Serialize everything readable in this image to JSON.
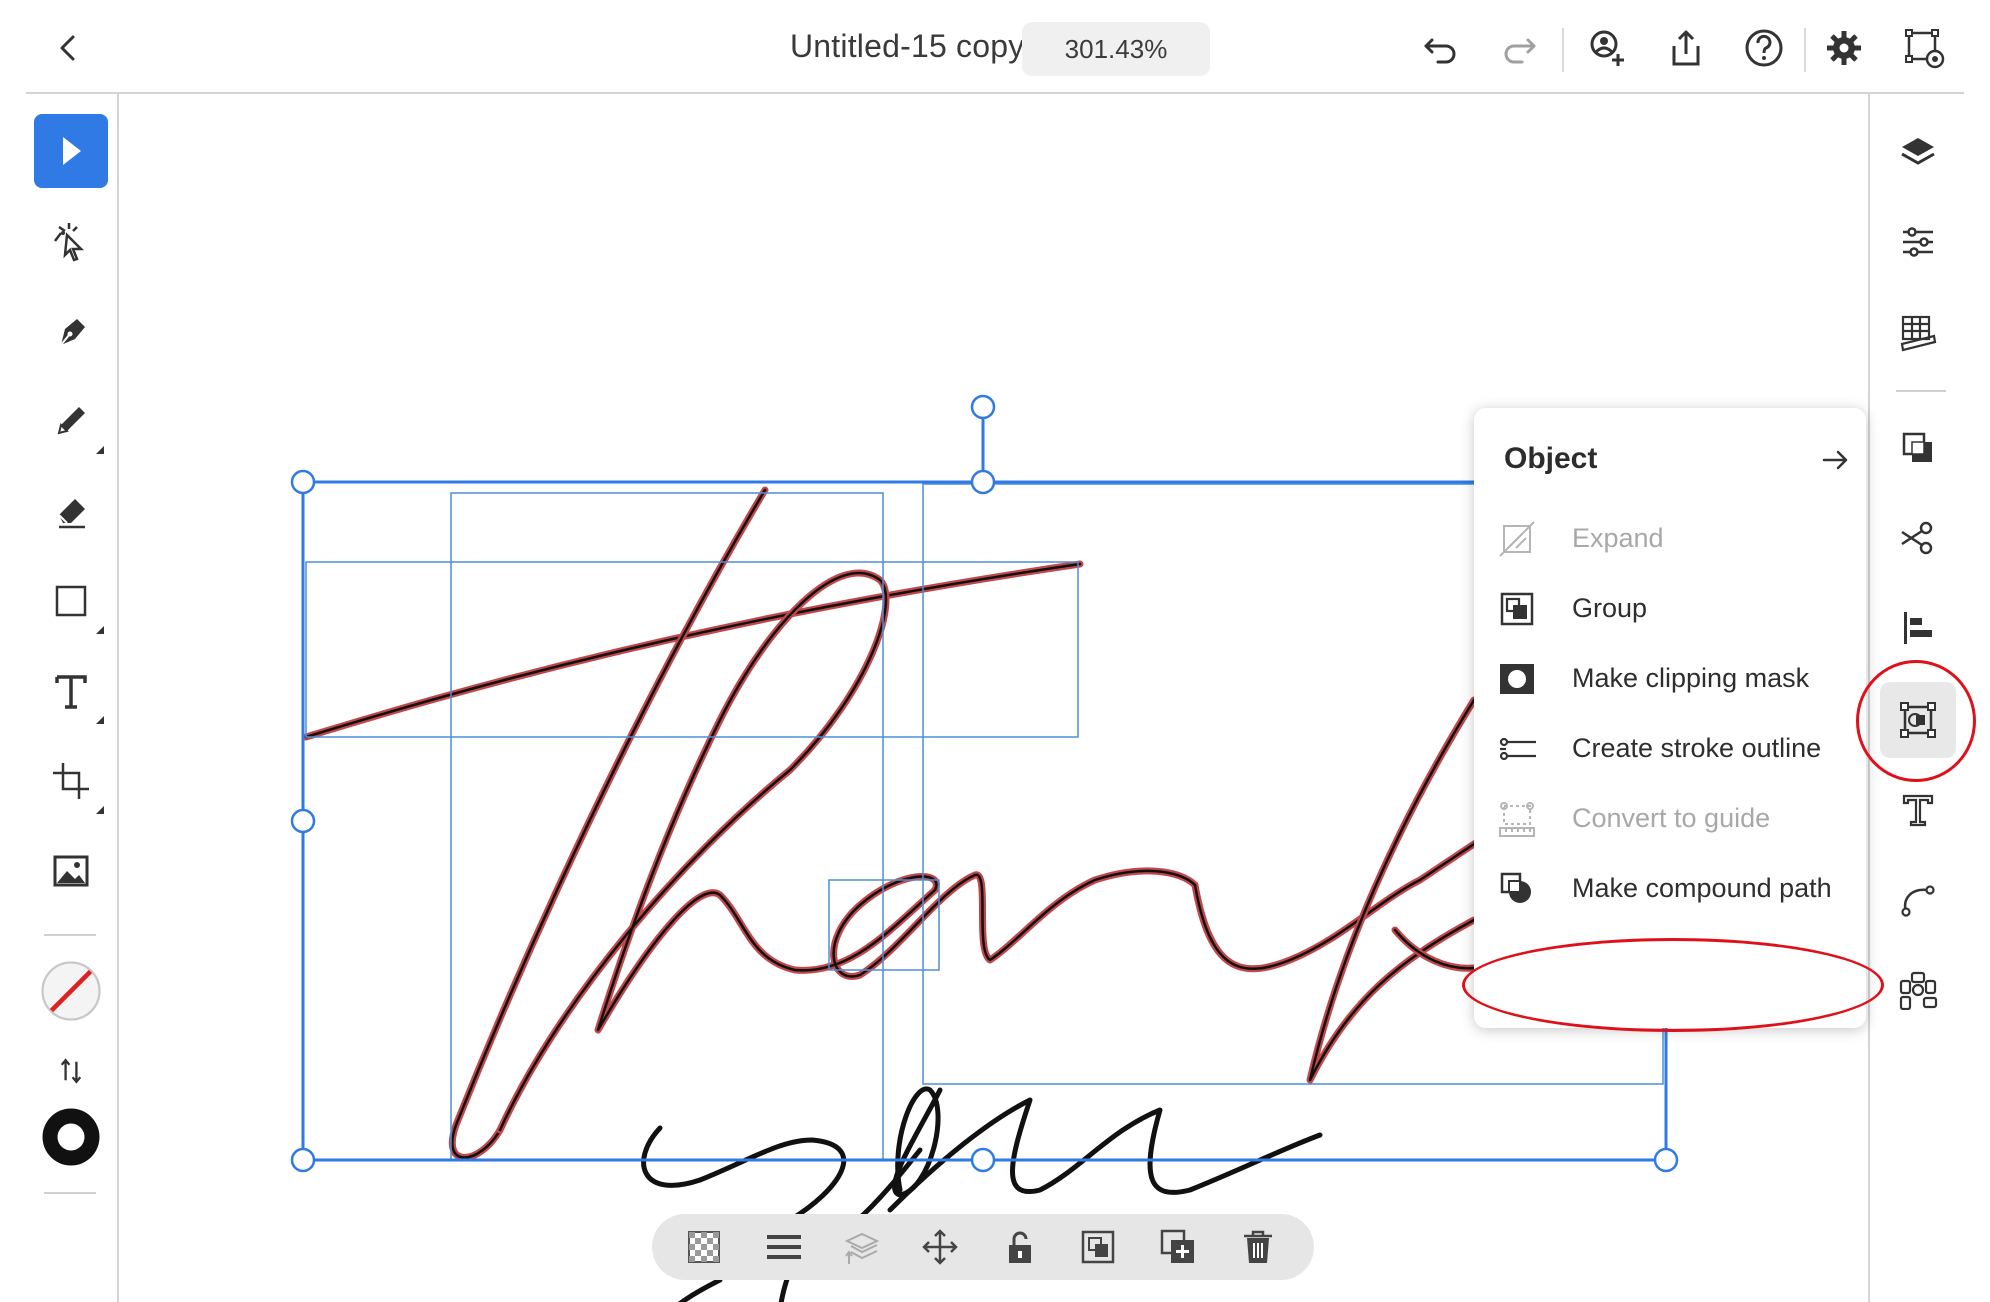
{
  "app": {
    "document_title": "Untitled-15 copy",
    "zoom_level": "301.43%"
  },
  "top_bar": {
    "icons": [
      "back-chevron-icon",
      "undo-icon",
      "redo-icon",
      "invite-user-icon",
      "share-icon",
      "help-icon",
      "settings-icon",
      "preview-icon"
    ]
  },
  "left_toolbar": {
    "tools": [
      "selection-tool",
      "direct-selection-tool",
      "pen-tool",
      "pencil-tool",
      "eraser-tool",
      "rectangle-tool",
      "type-tool",
      "artboard-tool",
      "place-image-tool"
    ],
    "active_tool": "selection-tool",
    "fill": "none",
    "stroke": "black"
  },
  "right_toolbar": {
    "icons": [
      "layers-icon",
      "properties-icon",
      "libraries-grid-icon",
      "pathfinder-icon",
      "scissors-icon",
      "align-icon",
      "object-icon",
      "type-icon",
      "path-icon",
      "repeat-icon"
    ],
    "active": "object-icon"
  },
  "object_panel": {
    "title": "Object",
    "items": [
      {
        "label": "Expand",
        "icon": "expand-icon",
        "enabled": false
      },
      {
        "label": "Group",
        "icon": "group-icon",
        "enabled": true
      },
      {
        "label": "Make clipping mask",
        "icon": "clipping-mask-icon",
        "enabled": true
      },
      {
        "label": "Create stroke outline",
        "icon": "stroke-outline-icon",
        "enabled": true
      },
      {
        "label": "Convert to guide",
        "icon": "guide-icon",
        "enabled": false
      },
      {
        "label": "Make compound path",
        "icon": "compound-path-icon",
        "enabled": true
      }
    ]
  },
  "bottom_toolbar": {
    "icons": [
      "transparency-icon",
      "arrange-icon",
      "layer-order-icon",
      "move-icon",
      "lock-icon",
      "group-icon",
      "duplicate-icon",
      "delete-icon"
    ]
  },
  "colors": {
    "accent": "#2f7ae5",
    "selection": "#3d82d6",
    "annotation": "#e0101a",
    "path_highlight": "#c0474a"
  }
}
